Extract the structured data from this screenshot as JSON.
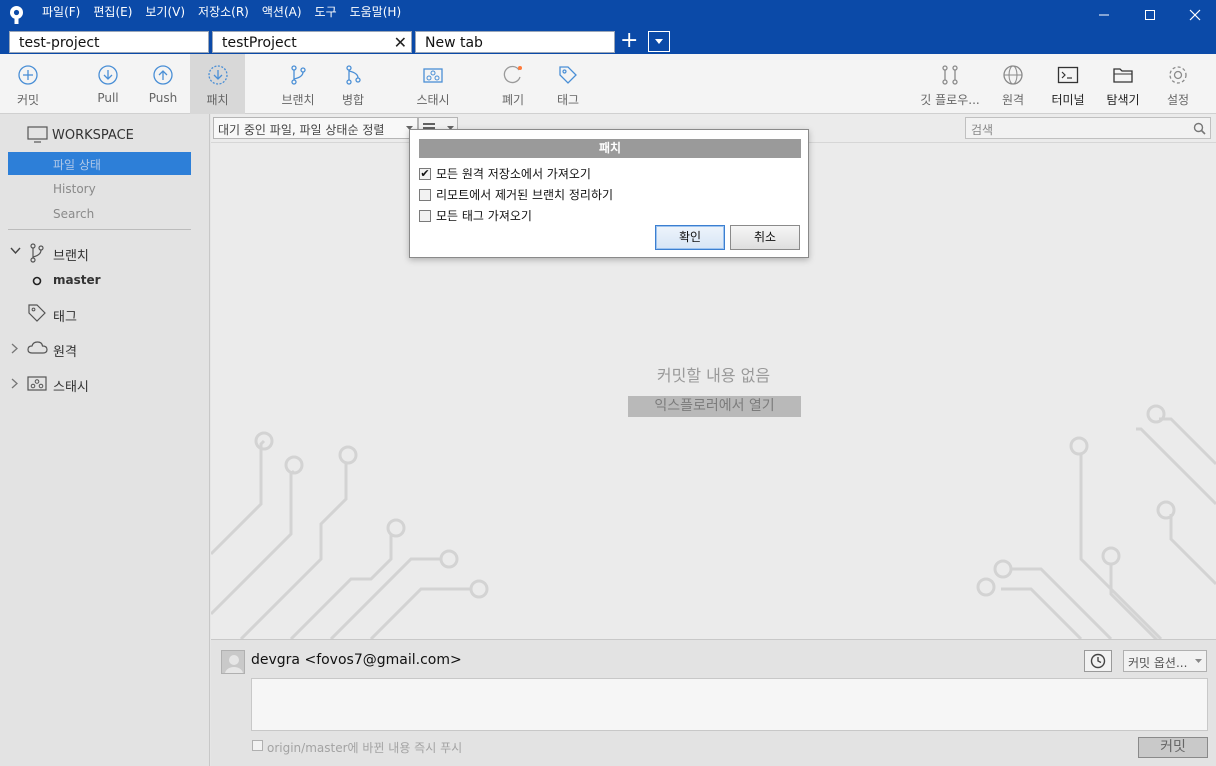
{
  "menu": [
    "파일(F)",
    "편집(E)",
    "보기(V)",
    "저장소(R)",
    "액션(A)",
    "도구",
    "도움말(H)"
  ],
  "tabs": [
    {
      "label": "test-project"
    },
    {
      "label": "testProject"
    },
    {
      "label": "New tab"
    }
  ],
  "toolbar": {
    "commit": "커밋",
    "pull": "Pull",
    "push": "Push",
    "fetch": "패치",
    "branch": "브랜치",
    "merge": "병합",
    "stash": "스태시",
    "discard": "폐기",
    "tag": "태그",
    "gitflow": "깃 플로우...",
    "remote": "원격",
    "terminal": "터미널",
    "explorer": "탐색기",
    "settings": "설정"
  },
  "sidebar": {
    "workspace": "WORKSPACE",
    "file_status": "파일 상태",
    "history": "History",
    "search": "Search",
    "branches": "브랜치",
    "master": "master",
    "tags": "태그",
    "remotes": "원격",
    "stashes": "스태시"
  },
  "main": {
    "filter": "대기 중인 파일, 파일 상태순 정렬",
    "search_placeholder": "검색",
    "empty_message": "커밋할 내용 없음",
    "open_explorer": "익스플로러에서 열기"
  },
  "commit": {
    "author": "devgra <fovos7@gmail.com>",
    "options": "커밋 옵션...",
    "push_label": "origin/master에 바뀐 내용 즉시 푸시",
    "button": "커밋"
  },
  "dialog": {
    "title": "패치",
    "options": [
      {
        "label": "모든 원격 저장소에서 가져오기",
        "checked": true
      },
      {
        "label": "리모트에서 제거된 브랜치 정리하기",
        "checked": false
      },
      {
        "label": "모든 태그 가져오기",
        "checked": false
      }
    ],
    "ok": "확인",
    "cancel": "취소"
  }
}
